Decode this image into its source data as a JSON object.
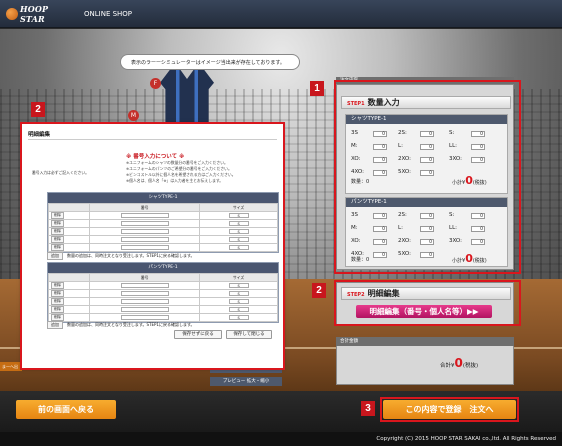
{
  "header": {
    "logo_text": "HOOP STAR",
    "shop_label": "ONLINE SHOP"
  },
  "tooltip": "表示のラーーシミュレーターはイメージ当出来が存在しております。",
  "badges": {
    "b1": "1",
    "b2a": "2",
    "b2b": "2",
    "b3": "3"
  },
  "modal": {
    "title": "明細編集",
    "note_title": "※ 番号入力について ※",
    "note_lines": [
      "※ユニフォームのシャツの数量分の番号をご入力ください。",
      "※ユニフォームのパンツのご希望分の番号をご入力ください。",
      "※ビンコストル以外に個人名を希望される方はご入力ください。",
      "※個人名は、個人名「※」は入力者を主とお伝えします。"
    ],
    "note_left": "番号入力は必ずご記入ください。",
    "shirt_section": "シャツTYPE-1",
    "pants_section": "パンツTYPE-1",
    "col_number": "番号",
    "col_size": "サイズ",
    "row_btn": "削除",
    "size_default": "S",
    "rows": [
      1,
      2,
      3,
      4,
      5
    ],
    "add_label": "追加",
    "add_note": "数量の追加は、同時注文となり受注します。STEP1に戻る確認します。",
    "btn_save": "保存せずに戻る",
    "btn_cancel": "保存して閉じる"
  },
  "order": {
    "panel_title": "注文内容",
    "step1": "STEP1",
    "step1_title": "数量入力",
    "shirt": {
      "title": "シャツTYPE-1",
      "sizes": [
        [
          "3S",
          "0"
        ],
        [
          "2S:",
          "0"
        ],
        [
          "S:",
          "0"
        ],
        [
          "M:",
          "0"
        ],
        [
          "L:",
          "0"
        ],
        [
          "LL:",
          "0"
        ],
        [
          "XO:",
          "0"
        ],
        [
          "2XO:",
          "0"
        ],
        [
          "3XO:",
          "0"
        ],
        [
          "4XO:",
          "0"
        ],
        [
          "5XO:",
          "0"
        ]
      ],
      "count": "数量：0",
      "subtotal_label": "小計¥",
      "subtotal": "0",
      "tax": "(税抜)"
    },
    "pants": {
      "title": "パンツTYPE-1",
      "sizes": [
        [
          "3S",
          "0"
        ],
        [
          "2S:",
          "0"
        ],
        [
          "S:",
          "0"
        ],
        [
          "M:",
          "0"
        ],
        [
          "L:",
          "0"
        ],
        [
          "LL:",
          "0"
        ],
        [
          "XO:",
          "0"
        ],
        [
          "2XO:",
          "0"
        ],
        [
          "3XO:",
          "0"
        ],
        [
          "4XO:",
          "0"
        ],
        [
          "5XO:",
          "0"
        ]
      ],
      "count": "数量：0",
      "subtotal_label": "小計¥",
      "subtotal": "0",
      "tax": "(税抜)"
    },
    "step2": "STEP2",
    "step2_title": "明細編集",
    "detail_btn": "明細編集（番号・個人名等）▶▶",
    "total_head": "合計金額",
    "total_label": "合計¥",
    "total": "0",
    "total_tax": "(税抜)"
  },
  "preview": "プレビュー 拡大・縮小",
  "behind_btn": "この内容で登録 注文へ",
  "left_strip": "ま一へ出",
  "footer": {
    "back": "前の画面へ戻る",
    "submit": "この内容で登録　注文へ",
    "copyright": "Copyright (C) 2015 HOOP STAR SAKAI co.,ltd. All Rights Reserved"
  }
}
